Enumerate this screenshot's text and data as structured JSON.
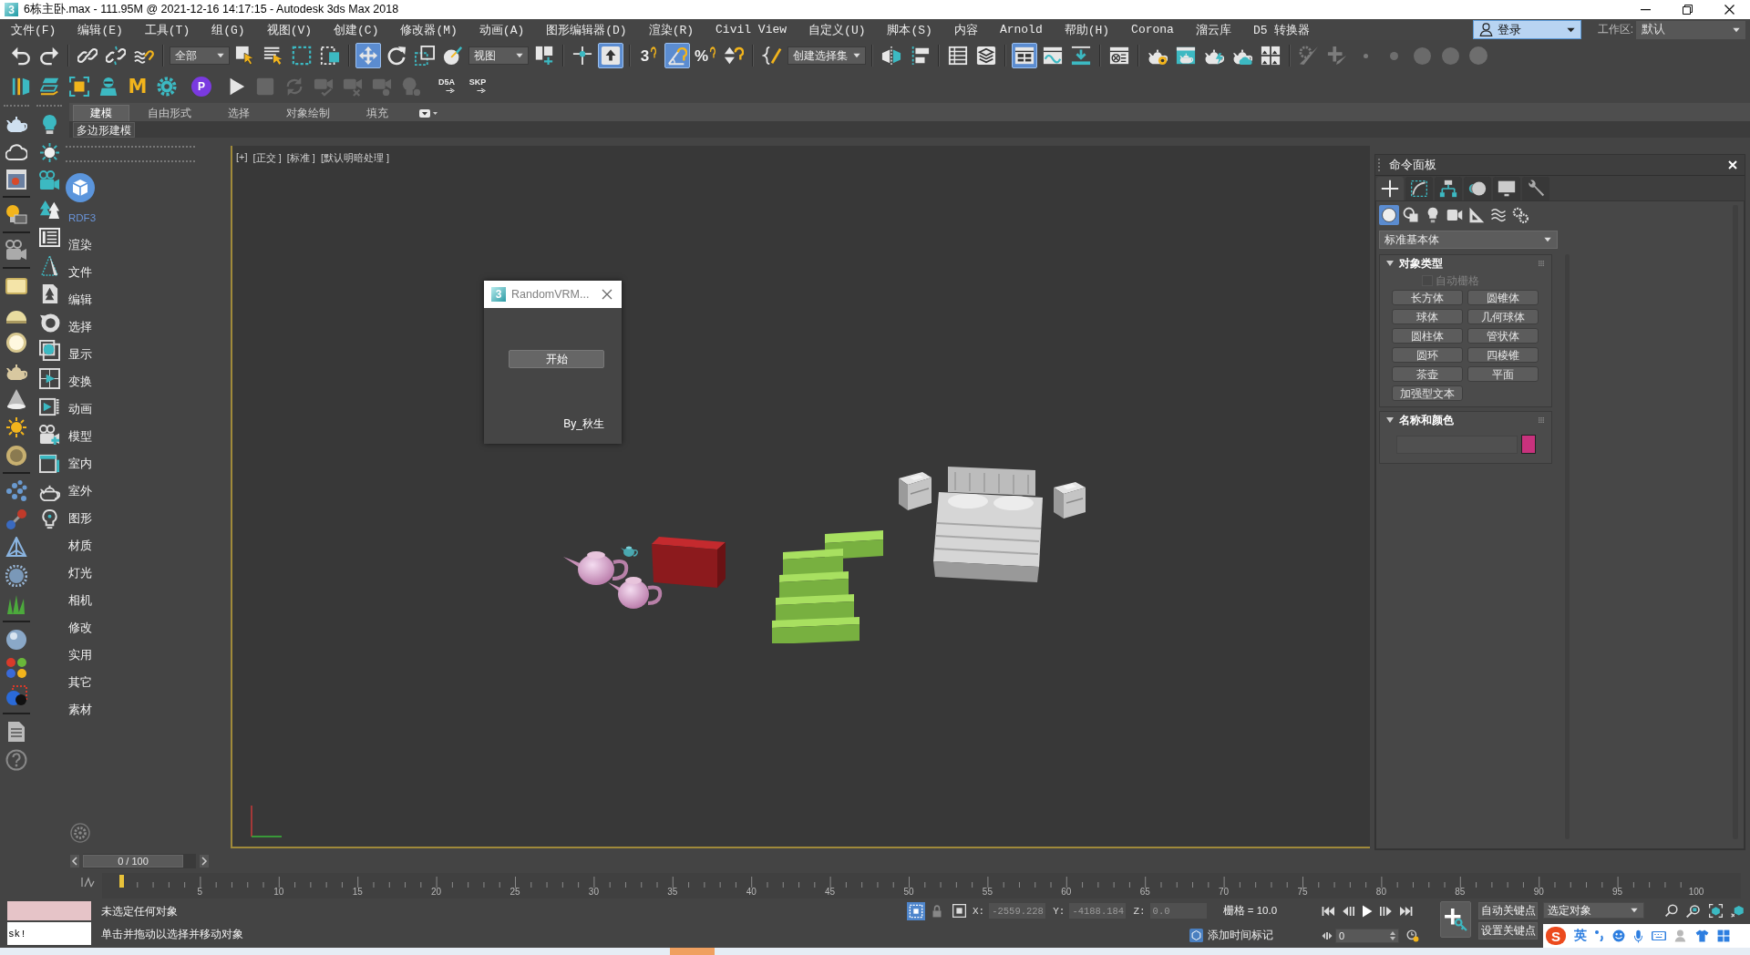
{
  "window": {
    "icon": "3",
    "title": "6栋主卧.max - 111.95M @ 2021-12-16 14:17:15 - Autodesk 3ds Max 2018"
  },
  "menu_bar": {
    "items": [
      "文件(F)",
      "编辑(E)",
      "工具(T)",
      "组(G)",
      "视图(V)",
      "创建(C)",
      "修改器(M)",
      "动画(A)",
      "图形编辑器(D)",
      "渲染(R)",
      "Civil View",
      "自定义(U)",
      "脚本(S)",
      "内容",
      "Arnold",
      "帮助(H)",
      "Corona",
      "溜云库",
      "D5 转换器"
    ],
    "account": "登录",
    "workspace_label": "工作区:",
    "workspace": "默认"
  },
  "main_toolbar": {
    "groups": [
      [
        {
          "kind": "button",
          "on": false
        },
        {
          "kind": "button",
          "on": false
        }
      ],
      [
        {
          "kind": "button",
          "on": false
        },
        {
          "kind": "button",
          "on": false
        },
        {
          "kind": "button",
          "on": false
        }
      ],
      [
        {
          "kind": "dropdown",
          "value": "全部"
        },
        {
          "kind": "button",
          "on": false
        },
        {
          "kind": "button",
          "on": false
        },
        {
          "kind": "button",
          "on": false
        },
        {
          "kind": "button",
          "on": false
        }
      ],
      [
        {
          "kind": "button",
          "on": true
        },
        {
          "kind": "button",
          "on": false
        },
        {
          "kind": "button",
          "on": false
        },
        {
          "kind": "button",
          "on": false
        },
        {
          "kind": "dropdown",
          "value": "视图"
        },
        {
          "kind": "button",
          "on": false
        }
      ],
      [
        {
          "kind": "button",
          "on": false
        },
        {
          "kind": "button",
          "on": true
        }
      ],
      [
        {
          "kind": "snap",
          "label": "3",
          "on": false
        },
        {
          "kind": "button",
          "on": true
        },
        {
          "kind": "snap",
          "label": "%",
          "on": false
        },
        {
          "kind": "button",
          "on": false
        }
      ],
      [
        {
          "kind": "button",
          "on": false
        },
        {
          "kind": "dropdown",
          "value": "创建选择集"
        }
      ],
      [
        {
          "kind": "button",
          "on": false
        },
        {
          "kind": "button",
          "on": false
        }
      ],
      [
        {
          "kind": "button",
          "on": false
        },
        {
          "kind": "button",
          "on": false
        }
      ],
      [
        {
          "kind": "button",
          "on": true
        },
        {
          "kind": "button",
          "on": false
        },
        {
          "kind": "button",
          "on": false
        }
      ],
      [
        {
          "kind": "button",
          "on": false
        }
      ],
      [
        {
          "kind": "button",
          "on": false
        },
        {
          "kind": "button",
          "on": false
        },
        {
          "kind": "button",
          "on": false
        },
        {
          "kind": "button",
          "on": false
        },
        {
          "kind": "button",
          "on": false
        }
      ],
      [
        {
          "kind": "button",
          "on": false
        },
        {
          "kind": "button",
          "on": false
        },
        {
          "kind": "button",
          "on": false
        },
        {
          "kind": "button",
          "on": false
        },
        {
          "kind": "button",
          "on": false
        },
        {
          "kind": "button",
          "on": false
        },
        {
          "kind": "button",
          "on": false
        }
      ]
    ]
  },
  "plugin_toolbar": {
    "groups": [
      [
        {
          "kind": "icon"
        },
        {
          "kind": "icon"
        },
        {
          "kind": "icon"
        },
        {
          "kind": "icon"
        },
        {
          "kind": "letter",
          "label": "M"
        },
        {
          "kind": "icon"
        }
      ],
      [
        {
          "kind": "badge",
          "label": "P"
        }
      ],
      [
        {
          "kind": "icon"
        },
        {
          "kind": "icon"
        },
        {
          "kind": "icon"
        },
        {
          "kind": "icon"
        },
        {
          "kind": "icon"
        },
        {
          "kind": "icon"
        },
        {
          "kind": "icon"
        }
      ],
      [
        {
          "kind": "export",
          "label": "D5A"
        },
        {
          "kind": "export",
          "label": "SKP"
        }
      ]
    ]
  },
  "ribbon": {
    "tabs": [
      {
        "label": "建模",
        "selected": true
      },
      {
        "label": "自由形式",
        "selected": false
      },
      {
        "label": "选择",
        "selected": false
      },
      {
        "label": "对象绘制",
        "selected": false
      },
      {
        "label": "填充",
        "selected": false
      }
    ],
    "panel": "多边形建模"
  },
  "script_panel": {
    "brand": "RDF3",
    "items": [
      "渲染",
      "文件",
      "编辑",
      "选择",
      "显示",
      "变换",
      "动画",
      "模型",
      "室内",
      "室外",
      "图形",
      "材质",
      "灯光",
      "相机",
      "修改",
      "实用",
      "其它",
      "素材"
    ]
  },
  "viewport": {
    "labels": [
      "[+]",
      "[正交 ]",
      "[标准 ]",
      "[默认明暗处理 ]"
    ]
  },
  "dialog": {
    "icon": "3",
    "title": "RandomVRM...",
    "button": "开始",
    "credit": "By_秋生"
  },
  "command_panel": {
    "title": "命令面板",
    "tabs": [
      {
        "selected": true
      },
      {
        "selected": false
      },
      {
        "selected": false
      },
      {
        "selected": false
      },
      {
        "selected": false
      },
      {
        "selected": false
      }
    ],
    "categories": [
      {
        "selected": true
      },
      {
        "selected": false
      },
      {
        "selected": false
      },
      {
        "selected": false
      },
      {
        "selected": false
      },
      {
        "selected": false
      },
      {
        "selected": false
      }
    ],
    "type": "标准基本体",
    "object_type": {
      "title": "对象类型",
      "expanded": true,
      "autogrid": {
        "label": "自动栅格",
        "checked": false,
        "disabled": true
      },
      "buttons": [
        "长方体",
        "圆锥体",
        "球体",
        "几何球体",
        "圆柱体",
        "管状体",
        "圆环",
        "四棱锥",
        "茶壶",
        "平面",
        "加强型文本"
      ]
    },
    "name_and_color": {
      "title": "名称和颜色",
      "expanded": true,
      "color": "#c8327d"
    }
  },
  "time_slider": {
    "label": "0 / 100",
    "level": 0
  },
  "timeline": {
    "ticks": [
      "5",
      "10",
      "15",
      "20",
      "25",
      "30",
      "35",
      "40",
      "45",
      "50",
      "55",
      "60",
      "65",
      "70",
      "75",
      "80",
      "85",
      "90",
      "95",
      "100"
    ]
  },
  "status_bar": {
    "listener": "sk!",
    "selection": "未选定任何对象",
    "prompt": "单击并拖动以选择并移动对象",
    "isolate_on": true,
    "coords": [
      {
        "label": "X:",
        "value": "-2559.228",
        "disabled": true
      },
      {
        "label": "Y:",
        "value": "-4188.184",
        "disabled": true
      },
      {
        "label": "Z:",
        "value": "0.0",
        "disabled": true
      }
    ],
    "grid": "栅格 = 10.0",
    "time_tag": "添加时间标记",
    "frame": "0",
    "auto_key": {
      "label": "自动关键点",
      "on": false
    },
    "set_key": "设置关键点",
    "key_filter": "选定对象"
  },
  "ime": {
    "logo": "S",
    "mode": "英"
  }
}
